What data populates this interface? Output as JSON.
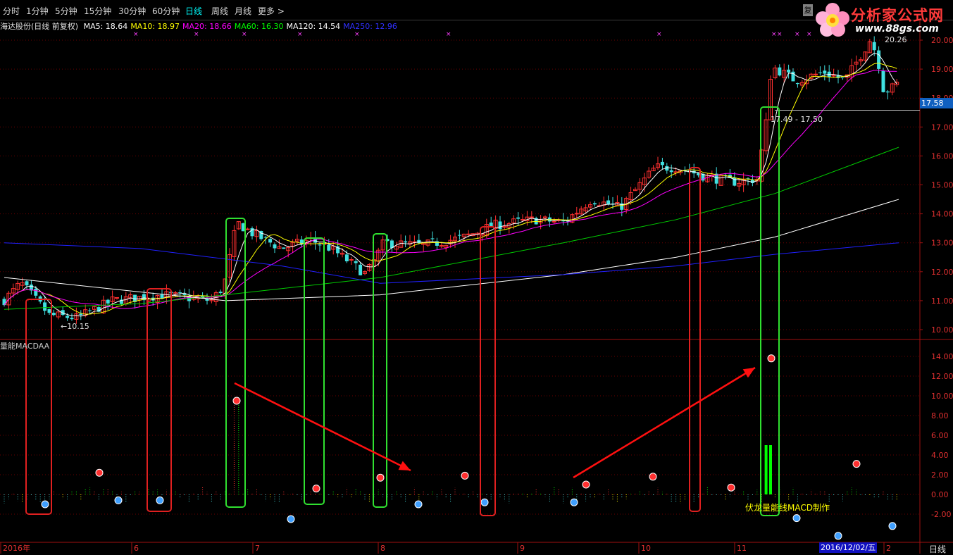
{
  "toolbar": {
    "periods": [
      "分时",
      "1分钟",
      "5分钟",
      "15分钟",
      "30分钟",
      "60分钟",
      "日线",
      "周线",
      "月线",
      "更多 >"
    ],
    "active": "日线"
  },
  "logo": {
    "name": "分析家公式网",
    "url": "www.88gs.com"
  },
  "legend": {
    "stock": "海达股份(日线 前复权)",
    "ma": [
      {
        "label": "MA5: 18.64",
        "color": "#ffffff"
      },
      {
        "label": "MA10: 18.97",
        "color": "#ffff00"
      },
      {
        "label": "MA20: 18.66",
        "color": "#ff00ff"
      },
      {
        "label": "MA60: 16.30",
        "color": "#00ff00"
      },
      {
        "label": "MA120: 14.54",
        "color": "#ffffff"
      },
      {
        "label": "MA250: 12.96",
        "color": "#3030ff"
      }
    ]
  },
  "price_axis": [
    "20.00",
    "19.00",
    "18.00",
    "17.00",
    "16.00",
    "15.00",
    "14.00",
    "13.00",
    "12.00",
    "11.00",
    "10.00"
  ],
  "indicator_axis": [
    "14.00",
    "12.00",
    "10.00",
    "8.00",
    "6.00",
    "4.00",
    "2.00",
    "0.00",
    "-2.00"
  ],
  "current_price": "17.58",
  "high_label": "20.26",
  "low_label": "←10.15",
  "range_label": "17.49 - 17.50",
  "indicator_name": "量能MACDAA",
  "credit": "伏龙量能线MACD制作",
  "date_tag": "2016/12/02/五",
  "period_tag": "日线",
  "x_labels": [
    "2016年",
    "6",
    "7",
    "8",
    "9",
    "10",
    "11",
    "2"
  ],
  "chart_data": {
    "type": "candlestick",
    "price_ylim": [
      9.7,
      20.3
    ],
    "indicator_ylim": [
      -3.2,
      15.0
    ],
    "ma_lines_end": {
      "MA5": 18.64,
      "MA10": 18.97,
      "MA20": 18.66,
      "MA60": 16.3,
      "MA120": 14.54,
      "MA250": 12.96
    },
    "series_colors": {
      "up": "#ff3030",
      "down": "#40e0e0",
      "ma5": "#ffffff",
      "ma10": "#ffff00",
      "ma20": "#ff00ff",
      "ma60": "#00cc00",
      "ma120": "#ffffff",
      "ma250": "#2020ff"
    }
  }
}
